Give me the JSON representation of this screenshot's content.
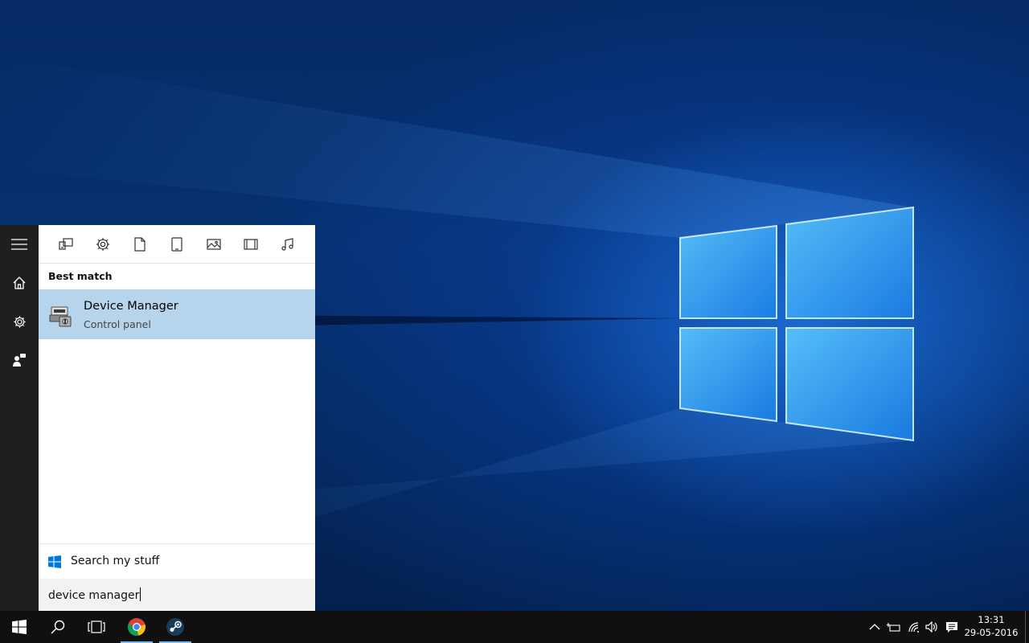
{
  "search_panel": {
    "section_title": "Best match",
    "best_match": {
      "title": "Device Manager",
      "subtitle": "Control panel"
    },
    "search_my_stuff_label": "Search my stuff",
    "search_query": "device manager",
    "filters": [
      "apps-icon",
      "settings-icon",
      "documents-icon",
      "tablet-icon",
      "photos-icon",
      "videos-icon",
      "music-icon"
    ]
  },
  "start_rail": [
    "hamburger-menu-icon",
    "home-icon",
    "settings-icon",
    "feedback-icon"
  ],
  "taskbar": {
    "apps": [
      "start-button",
      "search-button",
      "task-view-button",
      "chrome-app",
      "steam-app"
    ],
    "clock": {
      "time": "13:31",
      "date": "29-05-2016"
    }
  },
  "colors": {
    "selection": "#b6d4ec",
    "taskbar": "#101010",
    "rail": "#1f1f1f",
    "accent": "#76b9ed"
  }
}
